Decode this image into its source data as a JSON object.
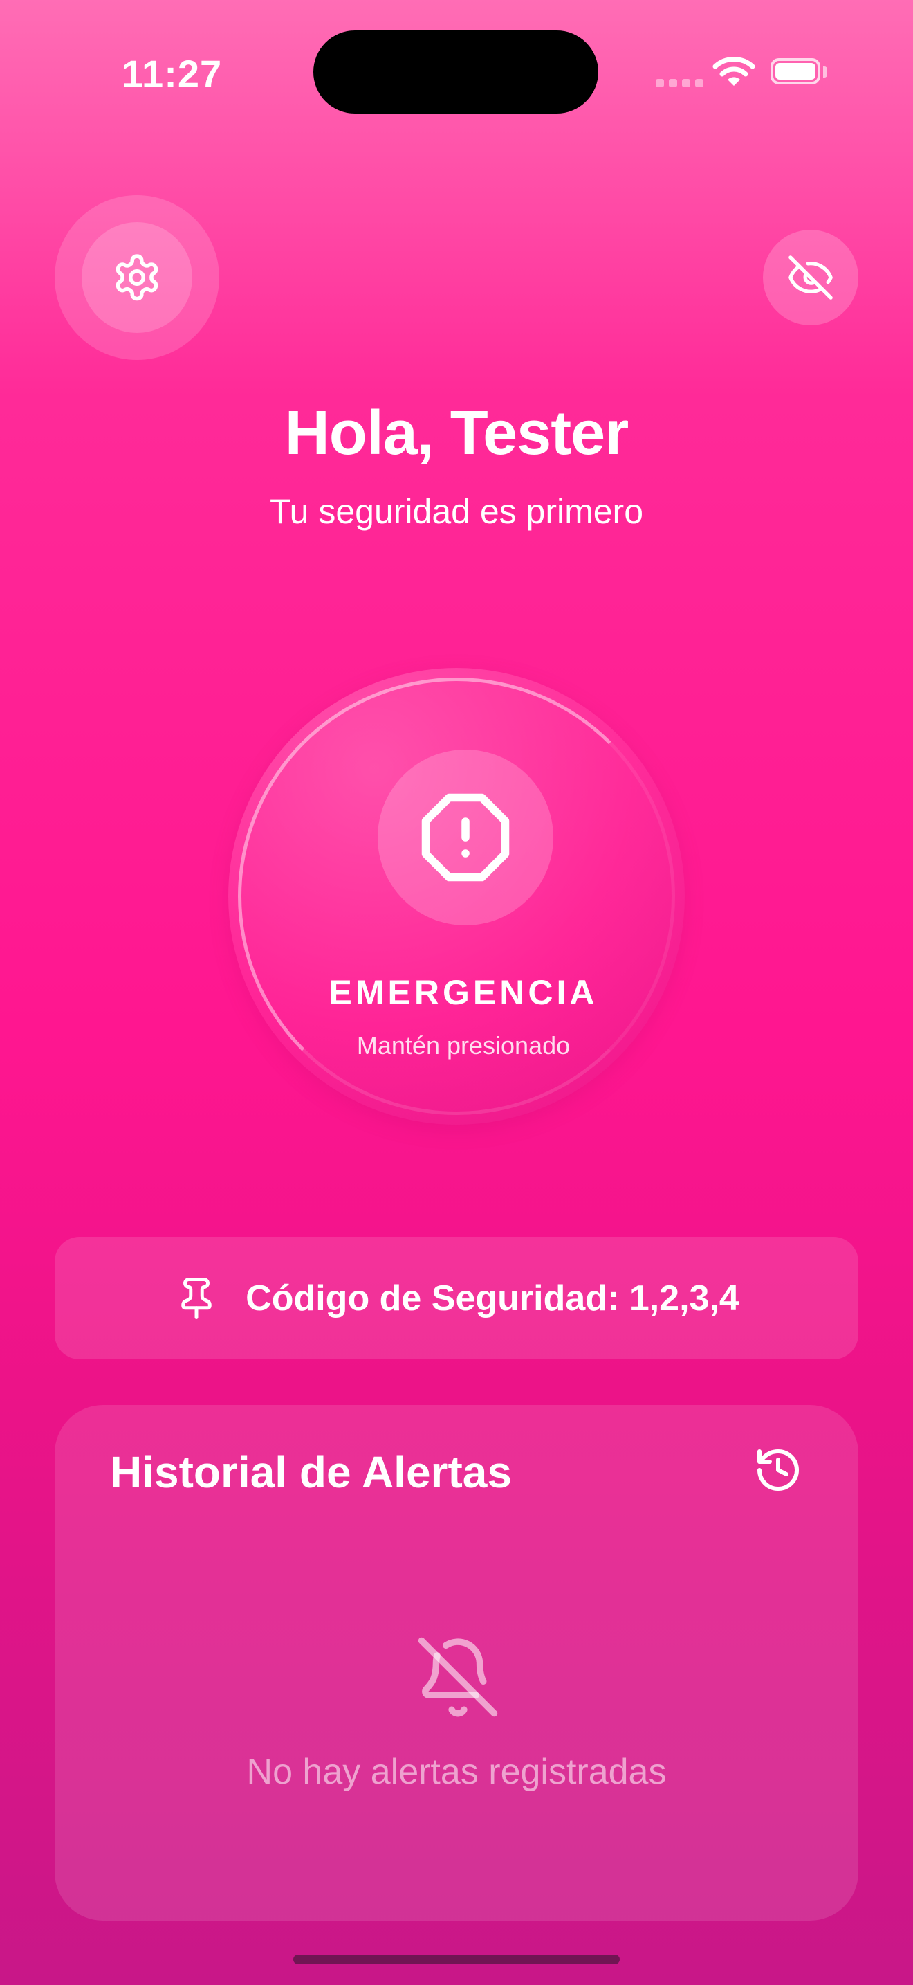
{
  "status_bar": {
    "time": "11:27"
  },
  "header": {
    "greeting": "Hola, Tester",
    "subtitle": "Tu seguridad es primero",
    "settings_icon": "gear-icon",
    "hide_icon": "eye-off-icon"
  },
  "emergency": {
    "label": "EMERGENCIA",
    "hint": "Mantén presionado",
    "icon": "octagon-alert-icon"
  },
  "security_code": {
    "text": "Código de Seguridad: 1,2,3,4",
    "icon": "pin-icon"
  },
  "history": {
    "title": "Historial de Alertas",
    "icon": "history-icon",
    "empty_icon": "bell-off-icon",
    "empty_text": "No hay alertas registradas"
  }
}
